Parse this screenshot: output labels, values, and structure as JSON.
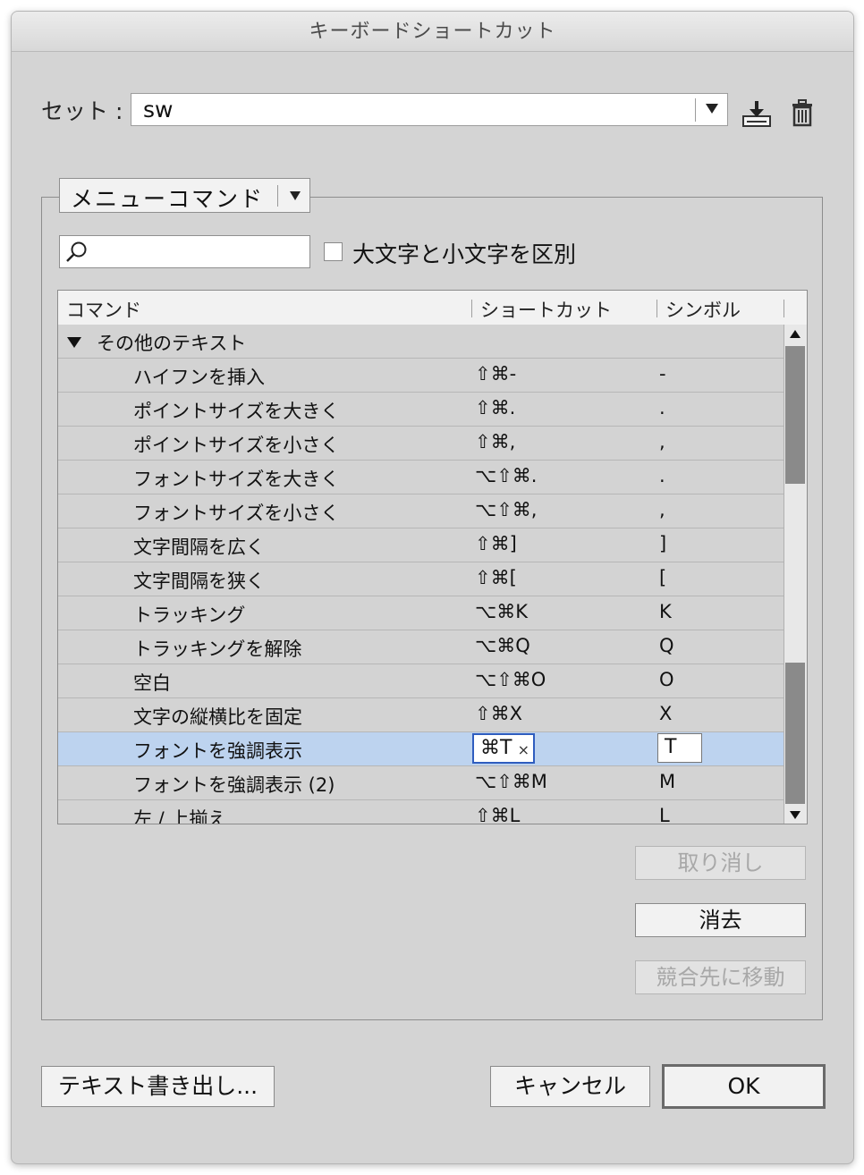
{
  "window": {
    "title": "キーボードショートカット"
  },
  "set": {
    "label": "セット :",
    "value": "sw"
  },
  "icons": {
    "save": "save-set-icon",
    "delete": "trash-icon",
    "search": "magnifier-icon"
  },
  "command_area": {
    "value": "メニューコマンド"
  },
  "search": {
    "placeholder": "",
    "value": ""
  },
  "case_checkbox": {
    "label": "大文字と小文字を区別",
    "checked": false
  },
  "table": {
    "headers": {
      "command": "コマンド",
      "shortcut": "ショートカット",
      "symbol": "シンボル"
    },
    "group": "その他のテキスト",
    "rows": [
      {
        "command": "ハイフンを挿入",
        "shortcut": "⇧⌘-",
        "symbol": "-"
      },
      {
        "command": "ポイントサイズを大きく",
        "shortcut": "⇧⌘.",
        "symbol": "."
      },
      {
        "command": "ポイントサイズを小さく",
        "shortcut": "⇧⌘,",
        "symbol": ","
      },
      {
        "command": "フォントサイズを大きく",
        "shortcut": "⌥⇧⌘.",
        "symbol": "."
      },
      {
        "command": "フォントサイズを小さく",
        "shortcut": "⌥⇧⌘,",
        "symbol": ","
      },
      {
        "command": "文字間隔を広く",
        "shortcut": "⇧⌘]",
        "symbol": "]"
      },
      {
        "command": "文字間隔を狭く",
        "shortcut": "⇧⌘[",
        "symbol": "["
      },
      {
        "command": "トラッキング",
        "shortcut": "⌥⌘K",
        "symbol": "K"
      },
      {
        "command": "トラッキングを解除",
        "shortcut": "⌥⌘Q",
        "symbol": "Q"
      },
      {
        "command": "空白",
        "shortcut": "⌥⇧⌘O",
        "symbol": "O"
      },
      {
        "command": "文字の縦横比を固定",
        "shortcut": "⇧⌘X",
        "symbol": "X"
      }
    ],
    "selected": {
      "command": "フォントを強調表示",
      "shortcut": "⌘T",
      "clear": "×",
      "symbol": "T"
    },
    "rows_after": [
      {
        "command": "フォントを強調表示 (2)",
        "shortcut": "⌥⇧⌘M",
        "symbol": "M"
      },
      {
        "command": "左 / 上揃え",
        "shortcut": "⇧⌘L",
        "symbol": "L"
      }
    ]
  },
  "buttons": {
    "undo": "取り消し",
    "clear": "消去",
    "go_to_conflict": "競合先に移動",
    "export_text": "テキスト書き出し...",
    "cancel": "キャンセル",
    "ok": "OK"
  }
}
